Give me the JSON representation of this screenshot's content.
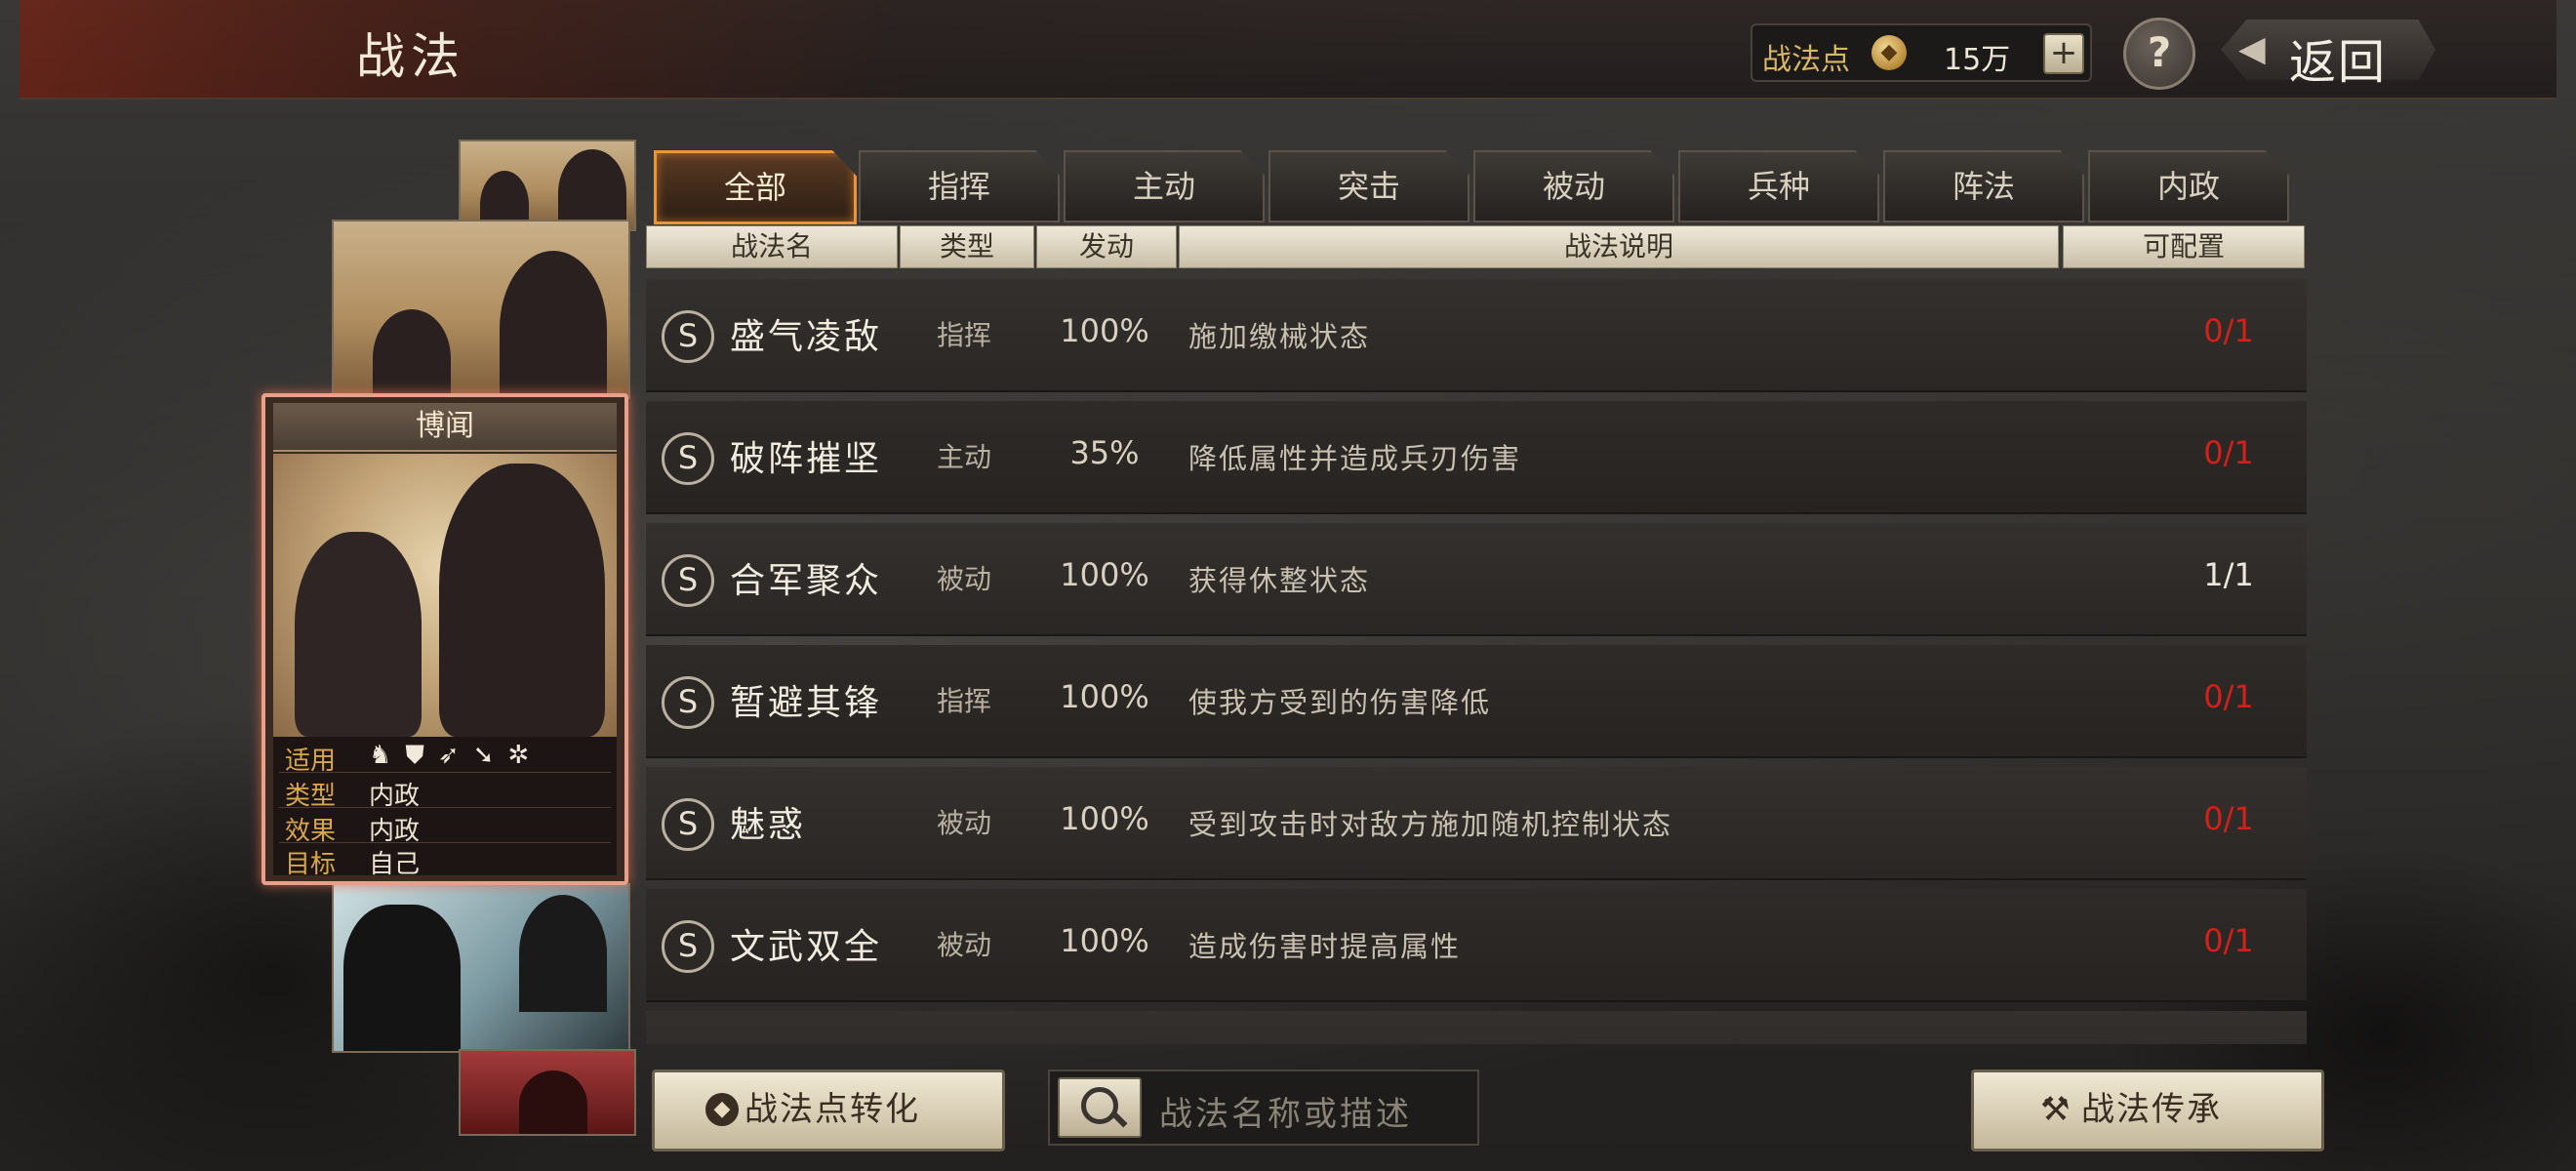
{
  "header": {
    "title": "战法",
    "points_label": "战法点",
    "points_value": "15万",
    "plus_label": "+",
    "help_label": "?",
    "back_label": "返回"
  },
  "selected_card": {
    "name": "博闻",
    "info": [
      {
        "key": "适用",
        "value": ""
      },
      {
        "key": "类型",
        "value": "内政"
      },
      {
        "key": "效果",
        "value": "内政"
      },
      {
        "key": "目标",
        "value": "自己"
      }
    ],
    "unit_icons": [
      "cavalry-icon",
      "shield-icon",
      "bow-icon",
      "spear-icon",
      "wheel-icon"
    ]
  },
  "tabs": [
    "全部",
    "指挥",
    "主动",
    "突击",
    "被动",
    "兵种",
    "阵法",
    "内政"
  ],
  "active_tab": 0,
  "columns": [
    "战法名",
    "类型",
    "发动",
    "战法说明",
    "可配置"
  ],
  "rows": [
    {
      "badge": "S",
      "name": "盛气凌敌",
      "type": "指挥",
      "rate": "100%",
      "desc": "施加缴械状态",
      "config": "0/1",
      "config_color": "#d2201a"
    },
    {
      "badge": "S",
      "name": "破阵摧坚",
      "type": "主动",
      "rate": "35%",
      "desc": "降低属性并造成兵刃伤害",
      "config": "0/1",
      "config_color": "#d2201a"
    },
    {
      "badge": "S",
      "name": "合军聚众",
      "type": "被动",
      "rate": "100%",
      "desc": "获得休整状态",
      "config": "1/1",
      "config_color": "#eee8dc"
    },
    {
      "badge": "S",
      "name": "暂避其锋",
      "type": "指挥",
      "rate": "100%",
      "desc": "使我方受到的伤害降低",
      "config": "0/1",
      "config_color": "#d2201a"
    },
    {
      "badge": "S",
      "name": "魅惑",
      "type": "被动",
      "rate": "100%",
      "desc": "受到攻击时对敌方施加随机控制状态",
      "config": "0/1",
      "config_color": "#d2201a"
    },
    {
      "badge": "S",
      "name": "文武双全",
      "type": "被动",
      "rate": "100%",
      "desc": "造成伤害时提高属性",
      "config": "0/1",
      "config_color": "#d2201a"
    }
  ],
  "bottom": {
    "convert_label": "战法点转化",
    "search_placeholder": "战法名称或描述",
    "inherit_label": "战法传承"
  }
}
